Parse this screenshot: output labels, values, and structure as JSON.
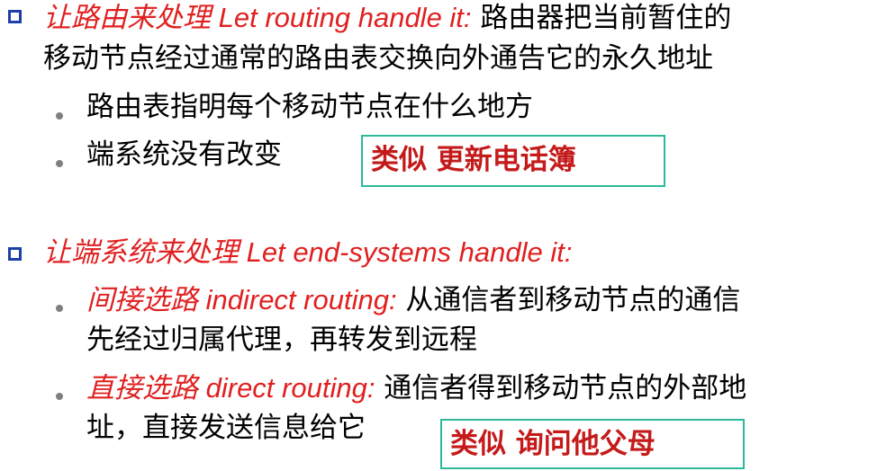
{
  "item1": {
    "title_cn": "让路由来处理",
    "title_en": " Let routing handle it:",
    "desc_line1": " 路由器把当前暂住的",
    "desc_line2": "移动节点经过通常的路由表交换向外通告它的永久地址",
    "sub_items": [
      {
        "text": "路由表指明每个移动节点在什么地方"
      },
      {
        "text": "端系统没有改变"
      }
    ],
    "analogy": "类似  更新电话簿"
  },
  "item2": {
    "title_cn": "让端系统来处理",
    "title_en": " Let end-systems handle it:",
    "sub_items": [
      {
        "term_cn": "间接选路",
        "term_en": " indirect routing:",
        "line1": " 从通信者到移动节点的通信",
        "line2": "先经过归属代理，再转发到远程"
      },
      {
        "term_cn": "直接选路",
        "term_en": " direct routing:",
        "line1": "  通信者得到移动节点的外部地",
        "line2": "址，直接发送信息给它"
      }
    ],
    "analogy": "类似  询问他父母"
  },
  "colors": {
    "bullet_square": "#1f3fa8",
    "term_red": "#e02020",
    "analogy_red": "#c41a1a",
    "box_border": "#2db89a"
  }
}
